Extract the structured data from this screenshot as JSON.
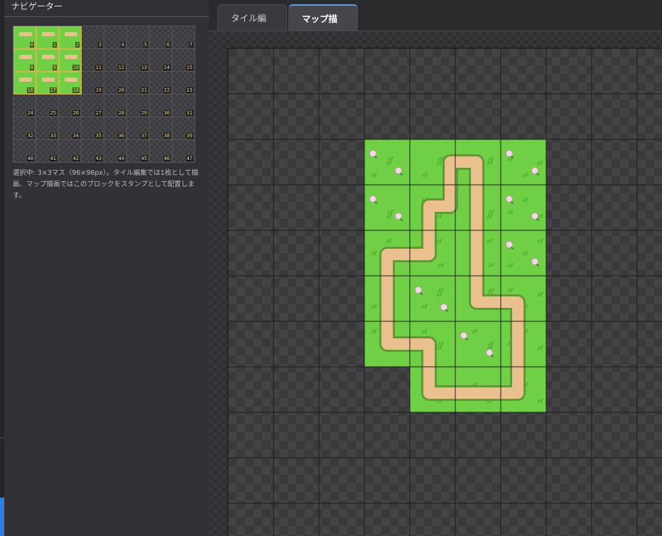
{
  "navigator": {
    "title": "ナビゲーター",
    "tiles": [
      {
        "label": "0",
        "filled": true,
        "selected": true
      },
      {
        "label": "1",
        "filled": true,
        "selected": true
      },
      {
        "label": "2",
        "filled": true,
        "selected": true
      },
      {
        "label": "3"
      },
      {
        "label": "4"
      },
      {
        "label": "5"
      },
      {
        "label": "6"
      },
      {
        "label": "7"
      },
      {
        "label": "8",
        "filled": true,
        "selected": true
      },
      {
        "label": "9",
        "filled": true,
        "selected": true
      },
      {
        "label": "10",
        "filled": true,
        "selected": true
      },
      {
        "label": "11"
      },
      {
        "label": "12"
      },
      {
        "label": "13"
      },
      {
        "label": "14"
      },
      {
        "label": "15"
      },
      {
        "label": "16",
        "filled": true,
        "selected": true
      },
      {
        "label": "17",
        "filled": true,
        "selected": true
      },
      {
        "label": "18",
        "filled": true,
        "selected": true
      },
      {
        "label": "19"
      },
      {
        "label": "20"
      },
      {
        "label": "21"
      },
      {
        "label": "22"
      },
      {
        "label": "23"
      },
      {
        "label": "24"
      },
      {
        "label": "25"
      },
      {
        "label": "26"
      },
      {
        "label": "27"
      },
      {
        "label": "28"
      },
      {
        "label": "29"
      },
      {
        "label": "30"
      },
      {
        "label": "31"
      },
      {
        "label": "32"
      },
      {
        "label": "33"
      },
      {
        "label": "34"
      },
      {
        "label": "35"
      },
      {
        "label": "36"
      },
      {
        "label": "37"
      },
      {
        "label": "38"
      },
      {
        "label": "39"
      },
      {
        "label": "40"
      },
      {
        "label": "41"
      },
      {
        "label": "42"
      },
      {
        "label": "43"
      },
      {
        "label": "44"
      },
      {
        "label": "45"
      },
      {
        "label": "46"
      },
      {
        "label": "47"
      }
    ],
    "selection_info": "選択中: 3×3マス（96×96px）。タイル編集では1枚として描画、マップ描画ではこのブロックをスタンプとして配置します。"
  },
  "tabs": [
    {
      "label": "タイル編集",
      "active": false
    },
    {
      "label": "マップ描画",
      "active": true
    }
  ],
  "map": {
    "painted_cells": [
      "3,2",
      "4,2",
      "5,2",
      "6,2",
      "3,3",
      "4,3",
      "5,3",
      "6,3",
      "3,4",
      "4,4",
      "5,4",
      "6,4",
      "3,5",
      "4,5",
      "5,5",
      "6,5",
      "3,6",
      "4,6",
      "5,6",
      "6,6",
      "4,7",
      "5,7",
      "6,7"
    ],
    "flowers": [
      "3,2",
      "6,2",
      "3,3",
      "6,3",
      "6,4",
      "4,5",
      "5,6"
    ]
  },
  "colors": {
    "grass": "#6fcf45",
    "grass_dark": "#4da82e",
    "path": "#e9c08e",
    "path_edge": "#5f9a34",
    "accent_tab": "#5aa0f0",
    "selection_outline": "#d9b44a"
  }
}
